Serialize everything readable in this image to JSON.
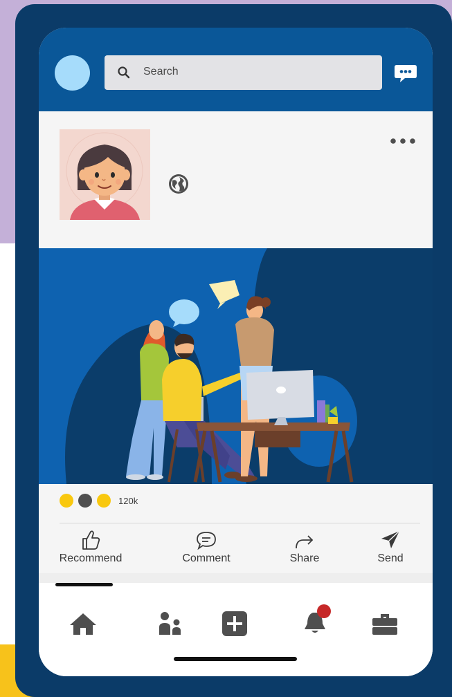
{
  "search": {
    "placeholder": "Search"
  },
  "icons": {
    "search": "search-icon",
    "chat": "chat-bubble-icon",
    "globe": "globe-icon",
    "more": "more-horizontal-icon",
    "recommend": "thumbs-up-icon",
    "comment": "comment-icon",
    "share": "share-arrow-icon",
    "send": "paper-plane-icon",
    "home": "home-icon",
    "network": "people-icon",
    "post": "plus-square-icon",
    "notifications": "bell-icon",
    "jobs": "briefcase-icon"
  },
  "post": {
    "reactions": {
      "colors": [
        "#f9c80e",
        "#4f4f4f",
        "#f9c80e"
      ],
      "count": "120k"
    },
    "actions": [
      {
        "label": "Recommend"
      },
      {
        "label": "Comment"
      },
      {
        "label": "Share"
      },
      {
        "label": "Send"
      }
    ]
  },
  "bottom_nav": {
    "active_index": 0,
    "notification_badge_color": "#c62828"
  },
  "colors": {
    "header": "#0a5798",
    "device_frame": "#0b3b68",
    "avatar": "#a6dcfb",
    "icon_gray": "#4f4f4f"
  }
}
